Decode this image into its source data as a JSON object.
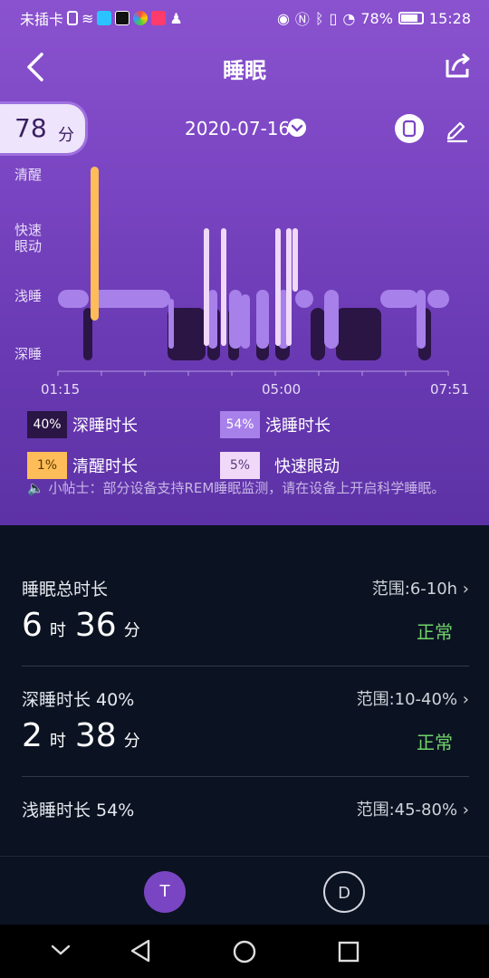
{
  "status_bar": {
    "carrier": "未插卡",
    "battery": "78%",
    "time": "15:28"
  },
  "header": {
    "title": "睡眠"
  },
  "score": {
    "value": "78",
    "unit": "分"
  },
  "date": "2020-07-16",
  "y_labels": [
    "清醒",
    "快速眼动",
    "浅睡",
    "深睡"
  ],
  "x_labels": [
    "01:15",
    "05:00",
    "07:51"
  ],
  "legend": [
    {
      "pct": "40%",
      "label": "深睡时长",
      "color": "#2a1545",
      "text_color": "#ffffff"
    },
    {
      "pct": "54%",
      "label": "浅睡时长",
      "color": "#a780ea",
      "text_color": "#ffffff"
    },
    {
      "pct": "1%",
      "label": "清醒时长",
      "color": "#ffbd59",
      "text_color": "#5a3a00"
    },
    {
      "pct": "5%",
      "label": "快速眼动",
      "color": "#f0d8f8",
      "text_color": "#5a3a7a"
    }
  ],
  "tip": "小帖士：部分设备支持REM睡眠监测，请在设备上开启科学睡眠。",
  "stats": [
    {
      "label": "睡眠总时长",
      "range": "范围:6-10h",
      "hours": "6",
      "h_unit": "时",
      "minutes": "36",
      "m_unit": "分",
      "status": "正常"
    },
    {
      "label": "深睡时长 40%",
      "range": "范围:10-40%",
      "hours": "2",
      "h_unit": "时",
      "minutes": "38",
      "m_unit": "分",
      "status": "正常"
    },
    {
      "label": "浅睡时长 54%",
      "range": "范围:45-80%",
      "hours": "",
      "h_unit": "",
      "minutes": "",
      "m_unit": "",
      "status": ""
    }
  ],
  "tabs": [
    {
      "label": "T"
    },
    {
      "label": "D"
    }
  ],
  "colors": {
    "deep": "#2a1545",
    "light": "#a780ea",
    "awake": "#ffbd59",
    "rem": "#f0d8f8",
    "accent_tab": "#7a45c2"
  }
}
